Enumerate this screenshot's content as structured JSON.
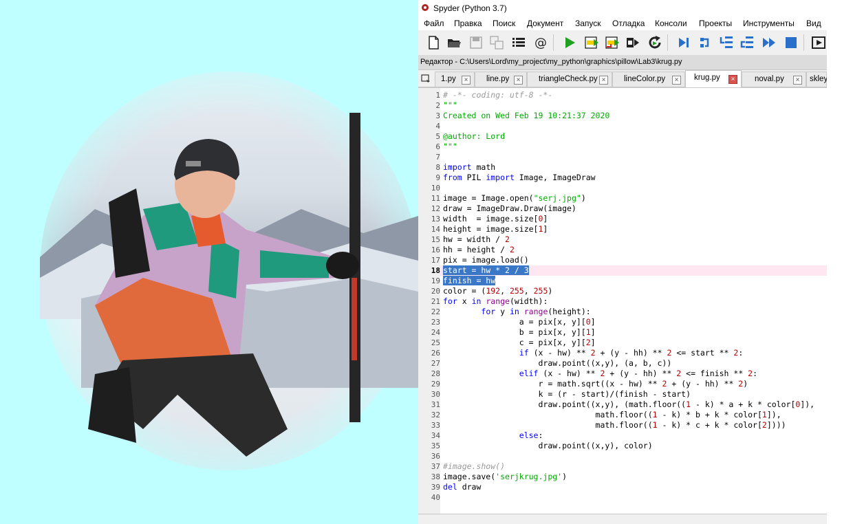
{
  "window": {
    "title": "Spyder (Python 3.7)"
  },
  "menubar": {
    "items": [
      "Файл",
      "Правка",
      "Поиск",
      "Документ",
      "Запуск",
      "Отладка",
      "Консоли",
      "Проекты",
      "Инструменты",
      "Вид"
    ]
  },
  "toolbar": {
    "buttons": [
      "new-file-icon",
      "open-file-icon",
      "save-icon",
      "save-all-icon",
      "outline-icon",
      "at-icon",
      "run-icon",
      "run-cell-icon",
      "run-cell-advance-icon",
      "run-selection-icon",
      "rerun-icon",
      "debug-icon",
      "step-icon",
      "step-into-icon",
      "step-return-icon",
      "continue-icon",
      "stop-icon",
      "maximize-icon"
    ],
    "colors": {
      "run_green": "#1fa11f",
      "debug_blue": "#2a6fc9"
    }
  },
  "editor": {
    "path_label": "Редактор - C:\\Users\\Lord\\my_project\\my_python\\graphics\\pillow\\Lab3\\krug.py",
    "tabs": [
      {
        "label": "1.py",
        "active": false
      },
      {
        "label": "line.py",
        "active": false
      },
      {
        "label": "triangleCheck.py",
        "active": false
      },
      {
        "label": "lineColor.py",
        "active": false
      },
      {
        "label": "krug.py",
        "active": true
      },
      {
        "label": "noval.py",
        "active": false
      },
      {
        "label": "skley",
        "active": false
      }
    ],
    "current_line": 18,
    "lines": [
      "# -*- coding: utf-8 -*-",
      "\"\"\"",
      "Created on Wed Feb 19 10:21:37 2020",
      "",
      "@author: Lord",
      "\"\"\"",
      "",
      "import math",
      "from PIL import Image, ImageDraw",
      "",
      "image = Image.open(\"serj.jpg\")",
      "draw = ImageDraw.Draw(image)",
      "width  = image.size[0]",
      "height = image.size[1]",
      "hw = width / 2",
      "hh = height / 2",
      "pix = image.load()",
      "start = hw * 2 / 3",
      "finish = hw",
      "color = (192, 255, 255)",
      "for x in range(width):",
      "        for y in range(height):",
      "                a = pix[x, y][0]",
      "                b = pix[x, y][1]",
      "                c = pix[x, y][2]",
      "                if (x - hw) ** 2 + (y - hh) ** 2 <= start ** 2:",
      "                    draw.point((x,y), (a, b, c))",
      "                elif (x - hw) ** 2 + (y - hh) ** 2 <= finish ** 2:",
      "                    r = math.sqrt((x - hw) ** 2 + (y - hh) ** 2)",
      "                    k = (r - start)/(finish - start)",
      "                    draw.point((x,y), (math.floor((1 - k) * a + k * color[0]),",
      "                                math.floor((1 - k) * b + k * color[1]),",
      "                                math.floor((1 - k) * c + k * color[2])))",
      "                else:",
      "                    draw.point((x,y), color)",
      "",
      "#image.show()",
      "image.save('serjkrug.jpg')",
      "del draw",
      ""
    ]
  },
  "photo": {
    "background_color": "#c0ffff"
  }
}
